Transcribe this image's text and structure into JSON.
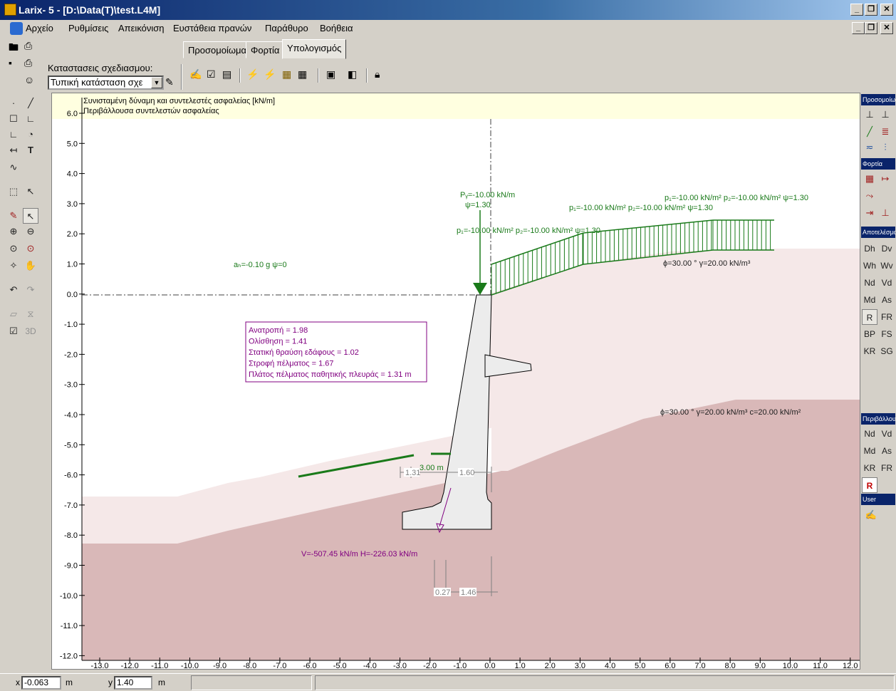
{
  "window": {
    "title": "Larix- 5 - [D:\\Data(T)\\test.L4M]"
  },
  "menu": [
    "Αρχείο",
    "Ρυθμίσεις",
    "Απεικόνιση",
    "Ευστάθεια πρανών",
    "Παράθυρο",
    "Βοήθεια"
  ],
  "tabs": [
    {
      "label": "Προσομοίωμα",
      "active": false
    },
    {
      "label": "Φορτία",
      "active": false
    },
    {
      "label": "Υπολογισμός",
      "active": true
    }
  ],
  "design_state": {
    "label": "Καταστασεις σχεδιασμου:",
    "value": "Τυπική κατάσταση σχε"
  },
  "canvas": {
    "header_line1": "Συνισταμένη δύναμη και συντελεστές ασφαλείας [kN/m]",
    "header_line2": "Περιβάλλουσα συντελεστών ασφαλείας",
    "y_ticks": [
      "6.0",
      "5.0",
      "4.0",
      "3.0",
      "2.0",
      "1.0",
      "0.0",
      "-1.0",
      "-2.0",
      "-3.0",
      "-4.0",
      "-5.0",
      "-6.0",
      "-7.0",
      "-8.0",
      "-9.0",
      "-10.0",
      "-11.0",
      "-12.0"
    ],
    "x_ticks": [
      "-13.0",
      "-12.0",
      "-11.0",
      "-10.0",
      "-9.0",
      "-8.0",
      "-7.0",
      "-6.0",
      "-5.0",
      "-4.0",
      "-3.0",
      "-2.0",
      "-1.0",
      "0.0",
      "1.0",
      "2.0",
      "3.0",
      "4.0",
      "5.0",
      "6.0",
      "7.0",
      "8.0",
      "9.0",
      "10.0",
      "11.0",
      "12.0"
    ],
    "results": [
      "Ανατροπή = 1.98",
      "Ολίσθηση = 1.41",
      "Στατική θραύση εδάφους = 1.02",
      "Στροφή πέλματος = 1.67",
      "Πλάτος πέλματος παθητικής πλευράς = 1.31 m"
    ],
    "labels": {
      "seismic": "aₕ=-0.10 g ψ=0",
      "point_load": "Pᵧ=-10.00 kN/m",
      "point_psi": "ψ=1.30",
      "load1": "p₁=-10.00 kN/m² p₂=-10.00 kN/m² ψ=1.30",
      "load2": "p₁=-10.00 kN/m² p₂=-10.00 kN/m² ψ=1.30",
      "load3": "p₁=-10.00 kN/m² p₂=-10.00 kN/m² ψ=1.30",
      "soil1": "ϕ=30.00 ° γ=20.00 kN/m³",
      "soil2": "ϕ=30.00 ° γ=20.00 kN/m³ c=20.00 kN/m²",
      "force": "V=-507.45 kN/m  H=-226.03 kN/m",
      "dim_131": "1.31",
      "dim_300": "3.00 m",
      "dim_160": "1.60",
      "dim_027": "0.27",
      "dim_146": "1.46"
    }
  },
  "right_panel": {
    "model_hdr": "Προσομοίωμα",
    "loads_hdr": "Φορτία",
    "results_hdr": "Αποτελέσματα",
    "results_btns": [
      "Dh",
      "Dv",
      "Wh",
      "Wv",
      "Nd",
      "Vd",
      "Md",
      "As",
      "R",
      "FR",
      "BP",
      "FS",
      "KR",
      "SG"
    ],
    "envelope_hdr": "Περιβάλλουσα",
    "envelope_btns": [
      "Nd",
      "Vd",
      "Md",
      "As",
      "KR",
      "FR",
      "R"
    ],
    "user_hdr": "User"
  },
  "left_tools": {
    "text_tool": "T",
    "view3d": "3D"
  },
  "status": {
    "x_label": "x",
    "x_value": "-0.063",
    "x_unit": "m",
    "y_label": "y",
    "y_value": "1.40",
    "y_unit": "m"
  },
  "colors": {
    "soil_lower": "#d9b8b8",
    "soil_upper": "#f5e8e8",
    "load_green": "#1a7a1a",
    "result_purple": "#800080",
    "header_bg": "#ffffe0"
  }
}
